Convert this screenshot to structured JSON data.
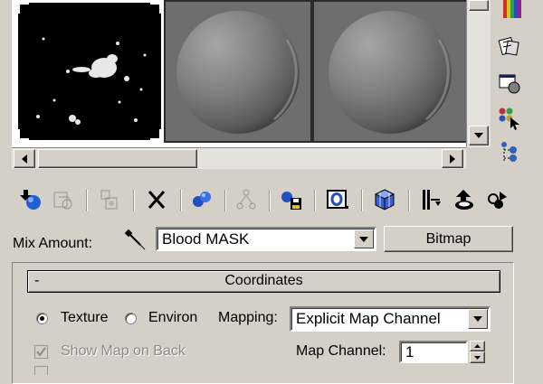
{
  "mix": {
    "label": "Mix Amount:",
    "map_name": "Blood MASK",
    "map_type": "Bitmap"
  },
  "coordinates": {
    "collapse_symbol": "-",
    "title": "Coordinates",
    "texture_label": "Texture",
    "environ_label": "Environ",
    "mapping_label": "Mapping:",
    "mapping_value": "Explicit Map Channel",
    "show_map_label": "Show Map on Back",
    "map_channel_label": "Map Channel:",
    "map_channel_value": "1"
  },
  "colors": {
    "panel": "#d4d0c8",
    "slot_gray": "#6e6e6e",
    "active_slot": "#000000"
  }
}
